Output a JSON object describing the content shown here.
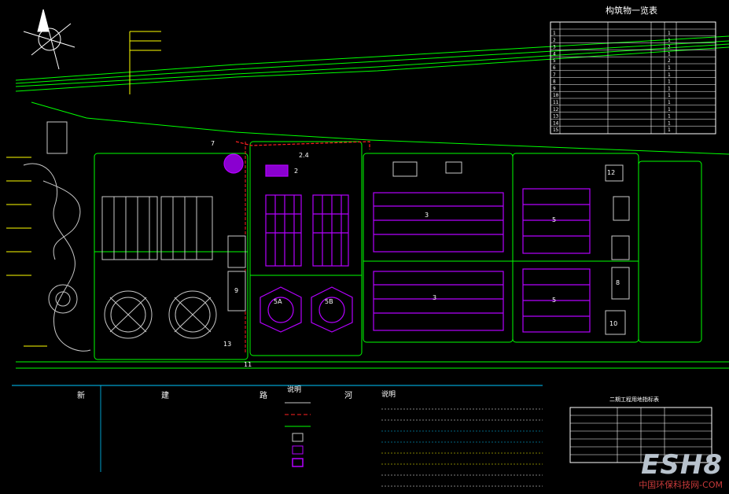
{
  "table_title": "构筑物一览表",
  "table_rows": [
    {
      "no": "1",
      "qty": "1"
    },
    {
      "no": "2",
      "qty": "1"
    },
    {
      "no": "3",
      "qty": "2"
    },
    {
      "no": "4",
      "qty": "1"
    },
    {
      "no": "5",
      "qty": "2"
    },
    {
      "no": "6",
      "qty": "1"
    },
    {
      "no": "7",
      "qty": "1"
    },
    {
      "no": "8",
      "qty": "1"
    },
    {
      "no": "9",
      "qty": "1"
    },
    {
      "no": "10",
      "qty": "1"
    },
    {
      "no": "11",
      "qty": "1"
    },
    {
      "no": "12",
      "qty": "1"
    },
    {
      "no": "13",
      "qty": "1"
    },
    {
      "no": "14",
      "qty": "1"
    },
    {
      "no": "15",
      "qty": "1"
    }
  ],
  "legend_title": "说明",
  "notes_title": "说明",
  "right_table_title": "二期工程用地指标表",
  "road_chars": [
    "新",
    "建",
    "路",
    "河"
  ],
  "unit_labels": {
    "u2": "2",
    "u24": "2.4",
    "u3a": "3",
    "u3b": "3",
    "u5a": "5",
    "u5b": "5",
    "u5A": "5A",
    "u5B": "5B",
    "u8": "8",
    "u9": "9",
    "u10": "10",
    "u11": "11",
    "u12": "12",
    "u13": "13",
    "u7": "7"
  },
  "watermark": {
    "logo": "ESH8",
    "site": "中国环保科技网-COM"
  },
  "colors": {
    "bg": "#000000",
    "road": "#00ff00",
    "new": "#b400ff",
    "old": "#c8c8c8",
    "boundary": "#ff2020",
    "text_yellow": "#ffff00",
    "dim": "#00c8ff"
  }
}
